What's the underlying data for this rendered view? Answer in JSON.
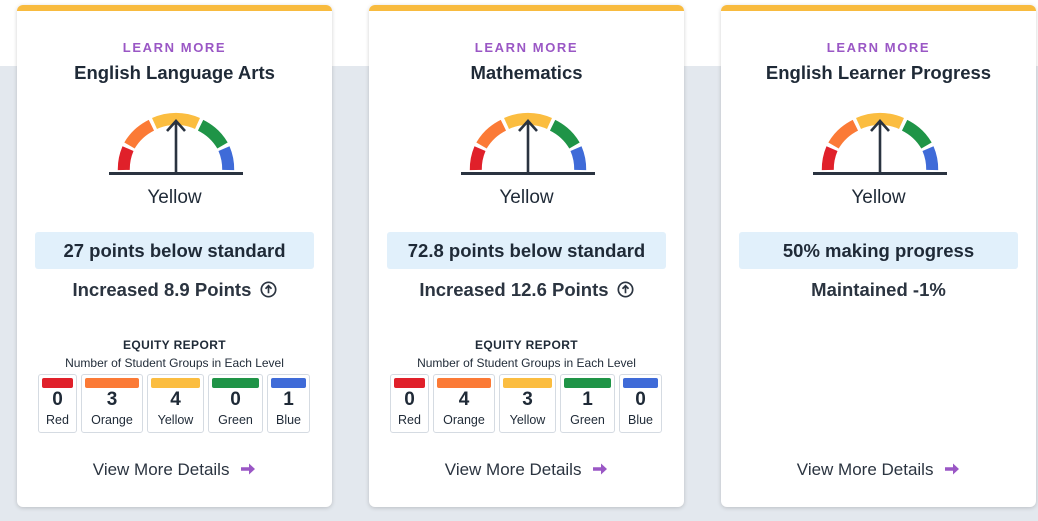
{
  "colors": {
    "accent_purple": "#9a57c5",
    "top_bar": "#f8bb3f",
    "red": "#e0202a",
    "orange": "#fb7a36",
    "yellow": "#fbbd40",
    "green": "#1f9447",
    "blue": "#3f6bd8",
    "highlight": "#e1f0fb"
  },
  "cards": [
    {
      "learn_more": "LEARN MORE",
      "title": "English Language Arts",
      "status": "Yellow",
      "standard": "27 points below standard",
      "change": "Increased 8.9 Points",
      "change_icon": "arrow-up-circle-icon",
      "equity": {
        "title": "EQUITY REPORT",
        "subtitle": "Number of Student Groups in Each Level",
        "levels": [
          {
            "label": "Red",
            "count": "0"
          },
          {
            "label": "Orange",
            "count": "3"
          },
          {
            "label": "Yellow",
            "count": "4"
          },
          {
            "label": "Green",
            "count": "0"
          },
          {
            "label": "Blue",
            "count": "1"
          }
        ]
      },
      "details": "View More Details"
    },
    {
      "learn_more": "LEARN MORE",
      "title": "Mathematics",
      "status": "Yellow",
      "standard": "72.8 points below standard",
      "change": "Increased 12.6 Points",
      "change_icon": "arrow-up-circle-icon",
      "equity": {
        "title": "EQUITY REPORT",
        "subtitle": "Number of Student Groups in Each Level",
        "levels": [
          {
            "label": "Red",
            "count": "0"
          },
          {
            "label": "Orange",
            "count": "4"
          },
          {
            "label": "Yellow",
            "count": "3"
          },
          {
            "label": "Green",
            "count": "1"
          },
          {
            "label": "Blue",
            "count": "0"
          }
        ]
      },
      "details": "View More Details"
    },
    {
      "learn_more": "LEARN MORE",
      "title": "English Learner Progress",
      "status": "Yellow",
      "standard": "50% making progress",
      "change": "Maintained -1%",
      "details": "View More Details"
    }
  ]
}
